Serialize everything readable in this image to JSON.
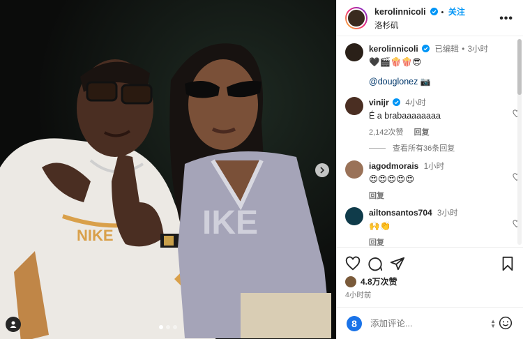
{
  "header": {
    "username": "kerolinnicoli",
    "follow_label": "关注",
    "dot": "•",
    "location": "洛杉矶",
    "more_label": "•••"
  },
  "caption": {
    "username": "kerolinnicoli",
    "edited_label": "已编辑",
    "dot": "•",
    "time": "3小时",
    "text": "🖤🎬🍿🍿😎",
    "mention": "@douglonez",
    "mention_suffix": "📷"
  },
  "comments": [
    {
      "username": "vinijr",
      "verified": true,
      "time": "4小时",
      "text": "É a brabaaaaaaaa",
      "likes": "2,142次赞",
      "reply_label": "回复",
      "view_replies": "查看所有36条回复"
    },
    {
      "username": "iagodmorais",
      "verified": false,
      "time": "1小时",
      "text": "😍😍😍😍😍",
      "reply_label": "回复"
    },
    {
      "username": "ailtonsantos704",
      "verified": false,
      "time": "3小时",
      "text": "🙌👏",
      "reply_label": "回复"
    }
  ],
  "footer": {
    "likes": "4.8万次赞",
    "posted": "4小时前",
    "add_comment_placeholder": "添加评论...",
    "emoji_badge": "8"
  },
  "icons": {
    "heart": "heart-icon",
    "comment": "comment-icon",
    "share": "share-icon",
    "save": "bookmark-icon",
    "verified": "verified-badge-icon"
  },
  "colors": {
    "accent": "#0095f6",
    "text": "#262626",
    "muted": "#737373"
  }
}
